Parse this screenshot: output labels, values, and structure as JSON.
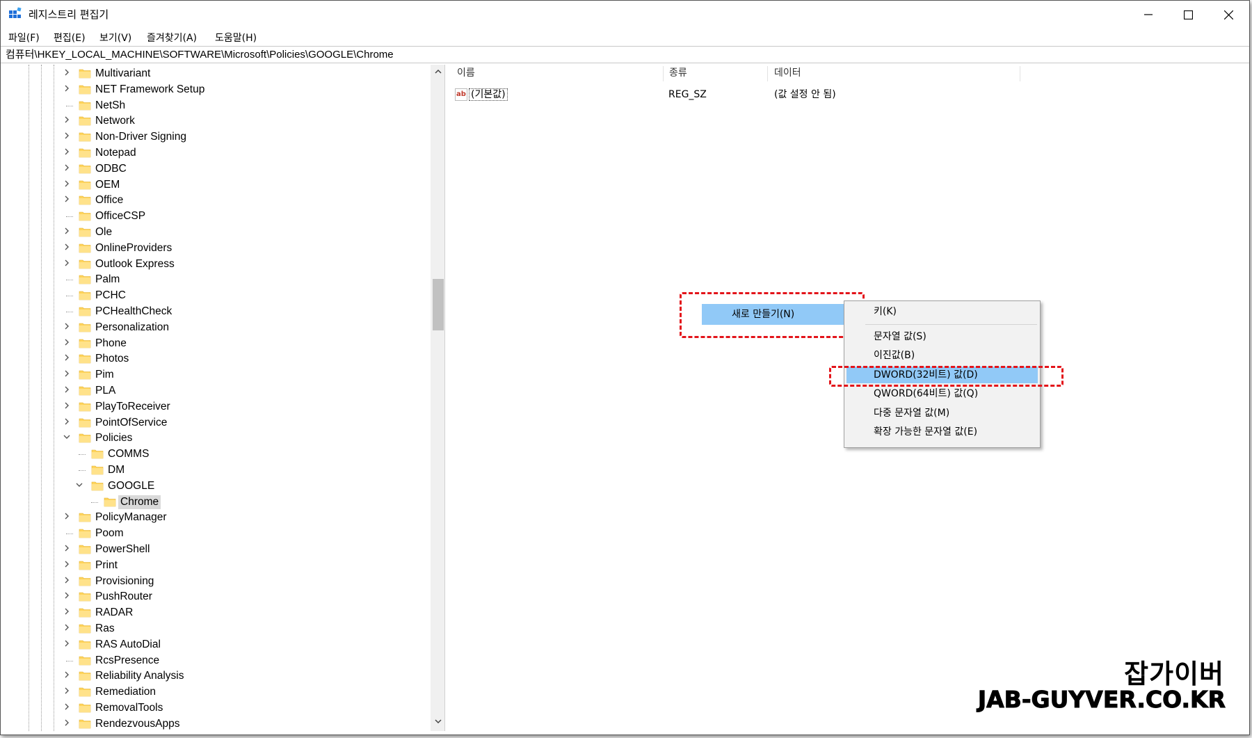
{
  "window": {
    "title": "레지스트리 편집기",
    "controls": {
      "minimize": "minimize",
      "maximize": "maximize",
      "close": "close"
    }
  },
  "menubar": [
    "파일(F)",
    "편집(E)",
    "보기(V)",
    "즐겨찾기(A)",
    "도움말(H)"
  ],
  "address": "컴퓨터\\HKEY_LOCAL_MACHINE\\SOFTWARE\\Microsoft\\Policies\\GOOGLE\\Chrome",
  "tree": {
    "items": [
      {
        "label": "Multivariant",
        "expander": "collapsed",
        "level": 0
      },
      {
        "label": "NET Framework Setup",
        "expander": "collapsed",
        "level": 0
      },
      {
        "label": "NetSh",
        "expander": "none",
        "level": 0
      },
      {
        "label": "Network",
        "expander": "collapsed",
        "level": 0
      },
      {
        "label": "Non-Driver Signing",
        "expander": "collapsed",
        "level": 0
      },
      {
        "label": "Notepad",
        "expander": "collapsed",
        "level": 0
      },
      {
        "label": "ODBC",
        "expander": "collapsed",
        "level": 0
      },
      {
        "label": "OEM",
        "expander": "collapsed",
        "level": 0
      },
      {
        "label": "Office",
        "expander": "collapsed",
        "level": 0
      },
      {
        "label": "OfficeCSP",
        "expander": "none",
        "level": 0
      },
      {
        "label": "Ole",
        "expander": "collapsed",
        "level": 0
      },
      {
        "label": "OnlineProviders",
        "expander": "collapsed",
        "level": 0
      },
      {
        "label": "Outlook Express",
        "expander": "collapsed",
        "level": 0
      },
      {
        "label": "Palm",
        "expander": "none",
        "level": 0
      },
      {
        "label": "PCHC",
        "expander": "none",
        "level": 0
      },
      {
        "label": "PCHealthCheck",
        "expander": "none",
        "level": 0
      },
      {
        "label": "Personalization",
        "expander": "collapsed",
        "level": 0
      },
      {
        "label": "Phone",
        "expander": "collapsed",
        "level": 0
      },
      {
        "label": "Photos",
        "expander": "collapsed",
        "level": 0
      },
      {
        "label": "Pim",
        "expander": "collapsed",
        "level": 0
      },
      {
        "label": "PLA",
        "expander": "collapsed",
        "level": 0
      },
      {
        "label": "PlayToReceiver",
        "expander": "collapsed",
        "level": 0
      },
      {
        "label": "PointOfService",
        "expander": "collapsed",
        "level": 0
      },
      {
        "label": "Policies",
        "expander": "expanded",
        "level": 0
      },
      {
        "label": "COMMS",
        "expander": "none",
        "level": 1
      },
      {
        "label": "DM",
        "expander": "none",
        "level": 1
      },
      {
        "label": "GOOGLE",
        "expander": "expanded",
        "level": 1
      },
      {
        "label": "Chrome",
        "expander": "none",
        "level": 2,
        "selected": true
      },
      {
        "label": "PolicyManager",
        "expander": "collapsed",
        "level": 0
      },
      {
        "label": "Poom",
        "expander": "none",
        "level": 0
      },
      {
        "label": "PowerShell",
        "expander": "collapsed",
        "level": 0
      },
      {
        "label": "Print",
        "expander": "collapsed",
        "level": 0
      },
      {
        "label": "Provisioning",
        "expander": "collapsed",
        "level": 0
      },
      {
        "label": "PushRouter",
        "expander": "collapsed",
        "level": 0
      },
      {
        "label": "RADAR",
        "expander": "collapsed",
        "level": 0
      },
      {
        "label": "Ras",
        "expander": "collapsed",
        "level": 0
      },
      {
        "label": "RAS AutoDial",
        "expander": "collapsed",
        "level": 0
      },
      {
        "label": "RcsPresence",
        "expander": "none",
        "level": 0
      },
      {
        "label": "Reliability Analysis",
        "expander": "collapsed",
        "level": 0
      },
      {
        "label": "Remediation",
        "expander": "collapsed",
        "level": 0
      },
      {
        "label": "RemovalTools",
        "expander": "collapsed",
        "level": 0
      },
      {
        "label": "RendezvousApps",
        "expander": "collapsed",
        "level": 0
      }
    ]
  },
  "values": {
    "columns": {
      "name": "이름",
      "type": "종류",
      "data": "데이터"
    },
    "rows": [
      {
        "icon": "ab",
        "name": "(기본값)",
        "type": "REG_SZ",
        "data": "(값 설정 안 됨)"
      }
    ]
  },
  "context_menu": {
    "new_item": "새로 만들기(N)",
    "submenu_arrow": "›",
    "submenu": [
      {
        "label": "키(K)"
      },
      {
        "label": "문자열 값(S)"
      },
      {
        "label": "이진값(B)"
      },
      {
        "label": "DWORD(32비트) 값(D)",
        "highlighted": true
      },
      {
        "label": "QWORD(64비트) 값(Q)"
      },
      {
        "label": "다중 문자열 값(M)"
      },
      {
        "label": "확장 가능한 문자열 값(E)"
      }
    ]
  },
  "watermark": {
    "korean": "잡가이버",
    "domain": "JAB-GUYVER.CO.KR"
  },
  "colors": {
    "highlight": "#91c9f7",
    "annotation": "#e3141a",
    "folder": "#ffd45c",
    "selection": "#d9d9d9"
  }
}
